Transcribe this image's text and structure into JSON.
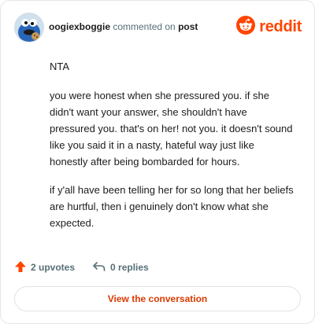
{
  "header": {
    "username": "oogiexboggie",
    "action_text": "commented on",
    "post_link": "post",
    "brand": "reddit",
    "avatar_icon": "cookie-monster-avatar-icon",
    "brand_icon": "reddit-snoo-icon"
  },
  "comment": {
    "paragraphs": [
      "NTA",
      "you were honest when she pressured you. if she didn't want your answer, she shouldn't have pressured you. that's on her! not you. it doesn't sound like you said it in a nasty, hateful way just like honestly after being bombarded for hours.",
      "if y'all have been telling her for so long that her beliefs are hurtful, then i genuinely don't know what she expected."
    ]
  },
  "stats": {
    "upvotes": "2 upvotes",
    "replies": "0 replies",
    "upvote_icon": "upvote-arrow-icon",
    "reply_icon": "reply-arrow-icon"
  },
  "cta": {
    "label": "View the conversation"
  },
  "colors": {
    "brand": "#ff4500",
    "cta_text": "#d93a00",
    "muted": "#576f76",
    "text": "#1c1c1c"
  }
}
